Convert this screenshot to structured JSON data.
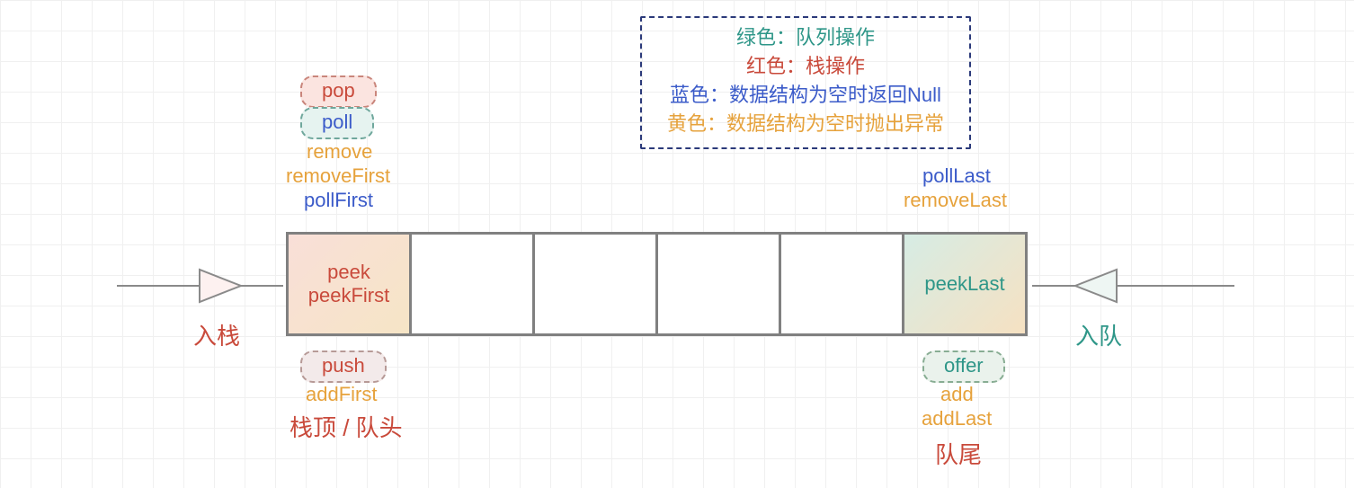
{
  "legend": {
    "green": "绿色：队列操作",
    "red": "红色：栈操作",
    "blue": "蓝色：数据结构为空时返回Null",
    "orange": "黄色：数据结构为空时抛出异常"
  },
  "left": {
    "pop": "pop",
    "poll": "poll",
    "remove": "remove",
    "removeFirst": "removeFirst",
    "pollFirst": "pollFirst",
    "peek": "peek",
    "peekFirst": "peekFirst",
    "push": "push",
    "addFirst": "addFirst",
    "head_label": "栈顶 / 队头",
    "stack_in": "入栈"
  },
  "right": {
    "pollLast": "pollLast",
    "removeLast": "removeLast",
    "peekLast": "peekLast",
    "offer": "offer",
    "add": "add",
    "addLast": "addLast",
    "tail_label": "队尾",
    "queue_in": "入队"
  }
}
